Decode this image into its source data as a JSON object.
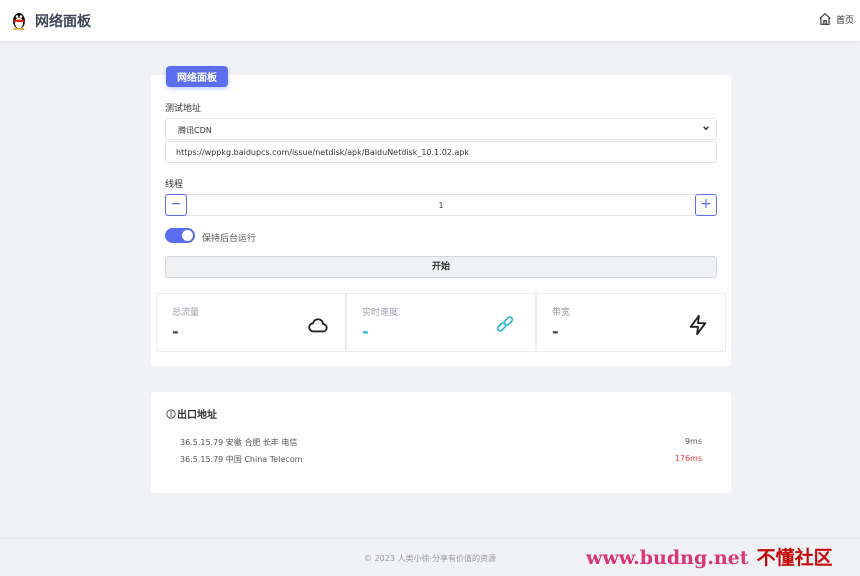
{
  "header": {
    "title": "网络面板",
    "home_label": "首页"
  },
  "panel": {
    "badge": "网络面板",
    "test_address_label": "测试地址",
    "selected_source": "腾讯CDN",
    "url_value": "https://wppkg.baidupcs.com/issue/netdisk/apk/BaiduNetdisk_10.1.02.apk",
    "threads_label": "线程",
    "threads_value": "1",
    "minus": "−",
    "plus": "+",
    "keep_running_label": "保持后台运行",
    "keep_running_on": true,
    "start_button": "开始"
  },
  "stats": [
    {
      "label": "总流量",
      "value": "-",
      "icon": "cloud-icon"
    },
    {
      "label": "实时速度",
      "value": "-",
      "icon": "link-icon"
    },
    {
      "label": "带宽",
      "value": "-",
      "icon": "lightning-icon"
    }
  ],
  "exit": {
    "title": "出口地址",
    "rows": [
      {
        "info": "36.5.15.79 安徽 合肥 长丰 电信",
        "ping": "9ms"
      },
      {
        "info": "36.5.15.79 中国 China Telecom",
        "ping": "176ms"
      }
    ]
  },
  "footer": {
    "text": "© 2023 人类小徐·分享有价值的资源"
  },
  "watermark": {
    "part1": "www.budng.net",
    "part2": "不懂社区"
  },
  "colors": {
    "accent": "#5b6ef0",
    "speed_value": "#29b6d6",
    "ping_slow": "#e53935",
    "watermark_pink": "#d9367a",
    "watermark_red": "#c40a0a"
  }
}
